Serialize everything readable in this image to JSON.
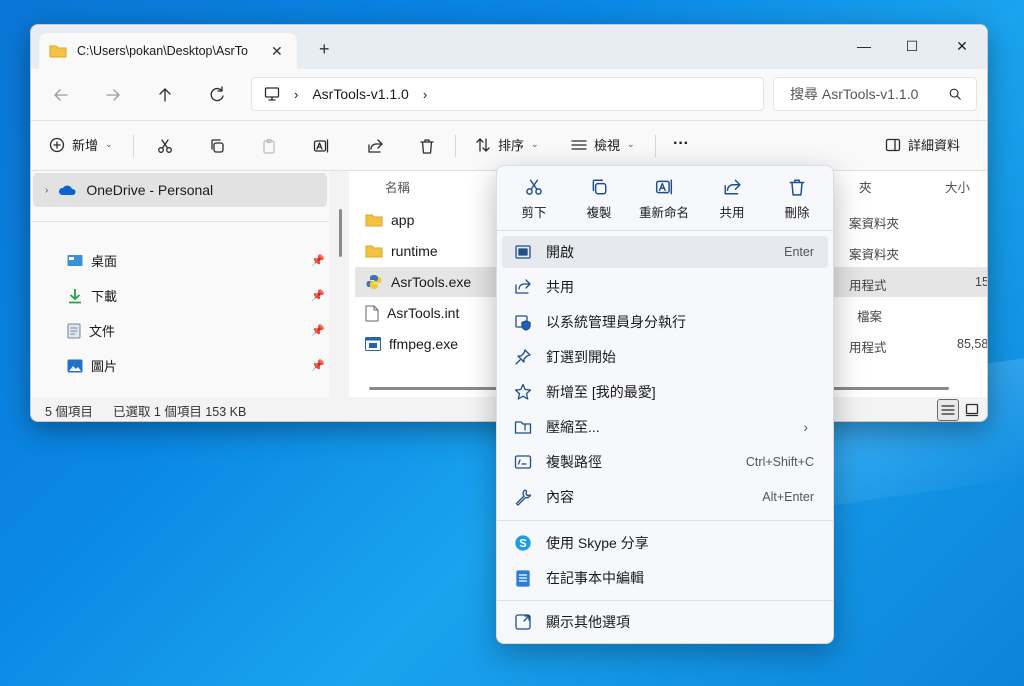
{
  "window": {
    "tab_title": "C:\\Users\\pokan\\Desktop\\AsrTo",
    "tab_close": "✕",
    "new_tab": "+",
    "controls": {
      "minimize": "—",
      "maximize": "☐",
      "close": "✕"
    }
  },
  "address": {
    "crumb": "AsrTools-v1.1.0",
    "search_placeholder": "搜尋 AsrTools-v1.1.0"
  },
  "toolbar": {
    "new_label": "新增",
    "sort_label": "排序",
    "view_label": "檢視",
    "more_label": "···",
    "details_label": "詳細資料"
  },
  "sidebar": {
    "onedrive": "OneDrive - Personal",
    "items": [
      {
        "label": "桌面",
        "icon": "desktop-icon"
      },
      {
        "label": "下載",
        "icon": "download-icon"
      },
      {
        "label": "文件",
        "icon": "document-icon"
      },
      {
        "label": "圖片",
        "icon": "picture-icon"
      }
    ]
  },
  "filepane": {
    "col_name": "名稱",
    "col_size": "大小",
    "files": [
      {
        "name": "app",
        "type": "folder"
      },
      {
        "name": "runtime",
        "type": "folder"
      },
      {
        "name": "AsrTools.exe",
        "type": "exe"
      },
      {
        "name": "AsrTools.int",
        "type": "file"
      },
      {
        "name": "ffmpeg.exe",
        "type": "exe"
      }
    ],
    "type_cells": [
      "夾",
      "案資料夾",
      "案資料夾",
      "用程式",
      "檔案",
      "用程式"
    ],
    "size_cells": [
      "15",
      "85,58"
    ]
  },
  "status": {
    "count": "5 個項目",
    "selected": "已選取 1 個項目  153 KB"
  },
  "context_menu": {
    "quick_actions": [
      {
        "label": "剪下",
        "icon": "cut-icon"
      },
      {
        "label": "複製",
        "icon": "copy-icon"
      },
      {
        "label": "重新命名",
        "icon": "rename-icon"
      },
      {
        "label": "共用",
        "icon": "share-icon"
      },
      {
        "label": "刪除",
        "icon": "delete-icon"
      }
    ],
    "items": [
      {
        "label": "開啟",
        "accel": "Enter"
      },
      {
        "label": "共用",
        "accel": ""
      },
      {
        "label": "以系統管理員身分執行",
        "accel": ""
      },
      {
        "label": "釘選到開始",
        "accel": ""
      },
      {
        "label": "新增至 [我的最愛]",
        "accel": ""
      },
      {
        "label": "壓縮至...",
        "accel": ""
      },
      {
        "label": "複製路徑",
        "accel": "Ctrl+Shift+C"
      },
      {
        "label": "內容",
        "accel": "Alt+Enter"
      },
      {
        "label": "使用 Skype 分享",
        "accel": ""
      },
      {
        "label": "在記事本中編輯",
        "accel": ""
      },
      {
        "label": "顯示其他選項",
        "accel": ""
      }
    ]
  },
  "colors": {
    "accent": "#0067c0",
    "folder": "#f5c342",
    "desktop_bg": "#0a88e4"
  }
}
